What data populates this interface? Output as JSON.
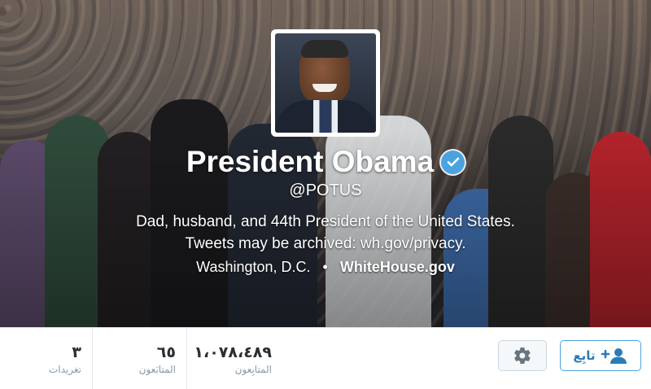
{
  "profile": {
    "name": "President Obama",
    "handle": "@POTUS",
    "bio": "Dad, husband, and 44th President of the United States. Tweets may be archived: wh.gov/privacy.",
    "location": "Washington, D.C.",
    "separator": "•",
    "website": "WhiteHouse.gov",
    "verified_icon": "verified-badge-icon"
  },
  "stats": [
    {
      "label": "تغريدات",
      "value": "٣"
    },
    {
      "label": "المتابَعون",
      "value": "٦٥"
    },
    {
      "label": "المتابِعون",
      "value": "١،٠٧٨،٤٨٩"
    }
  ],
  "actions": {
    "follow_label": "تابِع",
    "follow_icon": "add-user-icon",
    "settings_icon": "gear-icon"
  },
  "colors": {
    "accent": "#4aa3e0",
    "link": "#2b7bb9"
  }
}
